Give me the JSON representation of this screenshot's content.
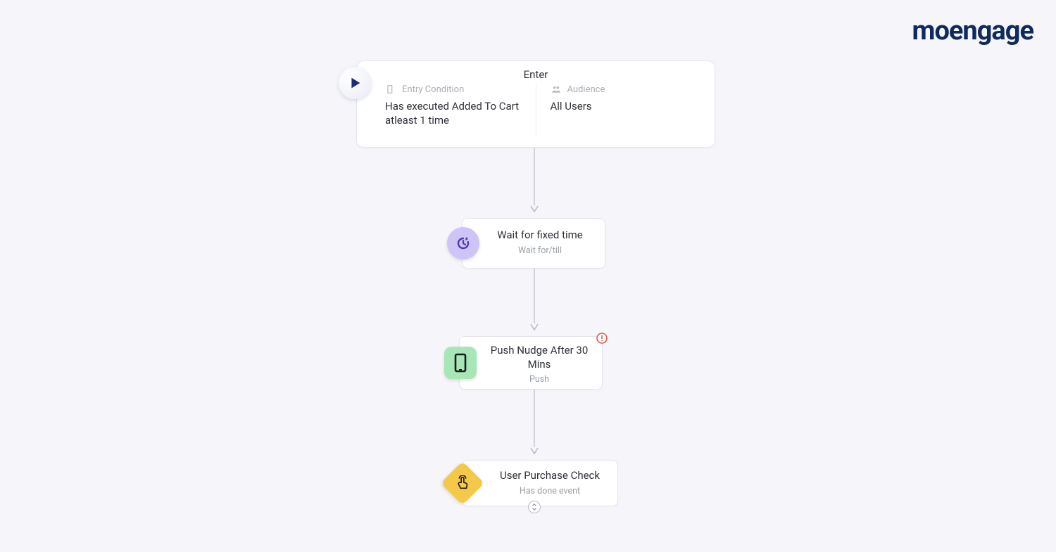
{
  "brand": {
    "name": "moengage"
  },
  "enter": {
    "title": "Enter",
    "entry_condition": {
      "label": "Entry Condition",
      "value": "Has executed Added To Cart atleast 1 time"
    },
    "audience": {
      "label": "Audience",
      "value": "All Users"
    }
  },
  "wait": {
    "title": "Wait for fixed time",
    "subtitle": "Wait for/till"
  },
  "push": {
    "title": "Push Nudge After 30 Mins",
    "subtitle": "Push"
  },
  "check": {
    "title": "User Purchase Check",
    "subtitle": "Has done event"
  }
}
